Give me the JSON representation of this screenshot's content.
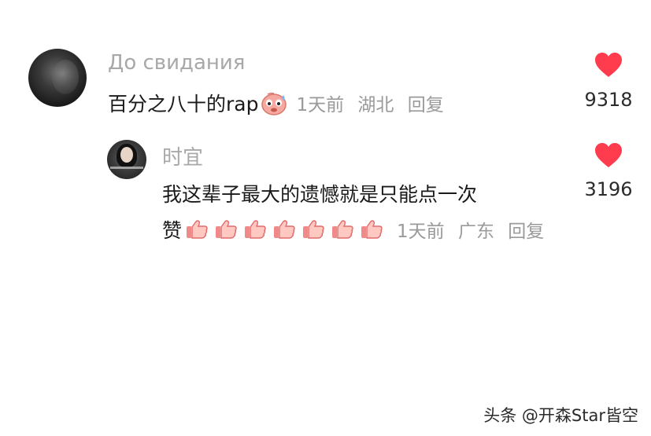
{
  "comments": {
    "main": {
      "username": "До свидания",
      "text": "百分之八十的rap",
      "emoji": "sweat-face-emoji",
      "time": "1天前",
      "location": "湖北",
      "reply_label": "回复",
      "likes": "9318"
    },
    "reply": {
      "username": "时宜",
      "text_line1": "我这辈子最大的遗憾就是只能点一次",
      "text_line2": "赞",
      "emoji": "thumbs-up-emoji",
      "emoji_count": 7,
      "time": "1天前",
      "location": "广东",
      "reply_label": "回复",
      "likes": "3196"
    }
  },
  "watermark": "头条 @开森Star皆空",
  "colors": {
    "heart": "#ff3b4e",
    "username": "#a8a8a8",
    "meta": "#9a9a9a",
    "text": "#1a1a1a"
  }
}
